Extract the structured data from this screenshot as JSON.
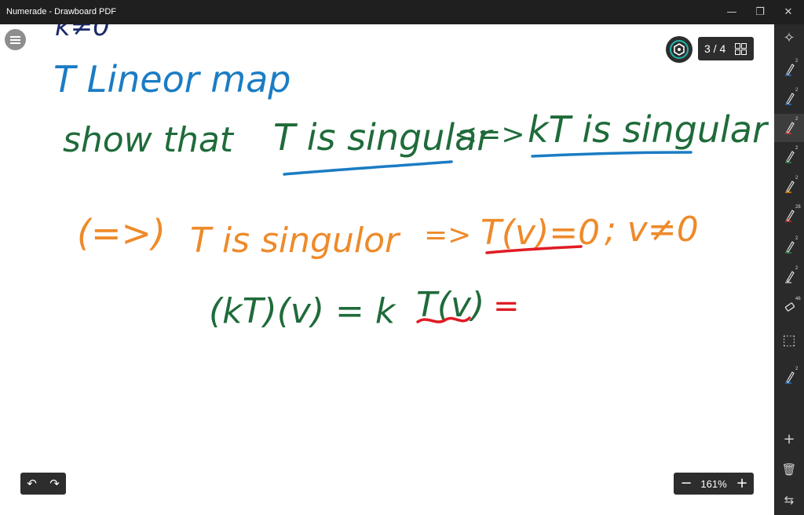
{
  "window": {
    "title": "Numerade - Drawboard PDF",
    "minimize_glyph": "—",
    "restore_glyph": "❐",
    "close_glyph": "✕"
  },
  "page_indicator": {
    "label": "3 / 4"
  },
  "zoom": {
    "label": "161%",
    "minus": "−",
    "plus": "+"
  },
  "undo": {
    "undo_glyph": "↶",
    "redo_glyph": "↷"
  },
  "sidebar": {
    "tools": [
      {
        "name": "pen-blue",
        "badge": "2",
        "color": "#2c77c2"
      },
      {
        "name": "pen-blue-2",
        "badge": "2",
        "color": "#2c77c2"
      },
      {
        "name": "pen-red",
        "badge": "2",
        "color": "#e03131"
      },
      {
        "name": "pen-green",
        "badge": "2",
        "color": "#2f8f4e"
      },
      {
        "name": "pen-orange",
        "badge": "2",
        "color": "#f08c00"
      },
      {
        "name": "highlighter-red",
        "badge": "28",
        "color": "#e03131"
      },
      {
        "name": "pen-green-2",
        "badge": "2",
        "color": "#2f8f4e"
      },
      {
        "name": "pen-grey",
        "badge": "2",
        "color": "#bfbfbf"
      },
      {
        "name": "eraser",
        "badge": "46",
        "color": "#bfbfbf"
      },
      {
        "name": "pen-teal",
        "badge": "2",
        "color": "#1c7ed6"
      }
    ],
    "top_icon": "✧",
    "select_glyph": "⬚",
    "add_glyph": "+",
    "delete_glyph": "🗑",
    "collapse_glyph": "⇆"
  },
  "handwriting": {
    "line_top_fragment": "k≠0",
    "line1": "T Lineor map",
    "line2_prefix": "show that",
    "line2_a": "T is singular",
    "line2_arrow": "<=>",
    "line2_b": "kT is singular",
    "line3_arrow": "(=>)",
    "line3_text": "T is singulor",
    "line3_implies": "=>",
    "line3_a": "T(v)=0",
    "line3_b": "; v≠0",
    "line4": "(kT)(v) = k",
    "line4_tv": "T(v)",
    "line4_eq": "=",
    "colors": {
      "dark_blue": "#1b2a6b",
      "blue": "#1b7cc4",
      "green": "#1f6b3a",
      "orange": "#ee8a2a",
      "underline_blue": "#1b7cc4",
      "underline_red": "#e01b24"
    }
  }
}
